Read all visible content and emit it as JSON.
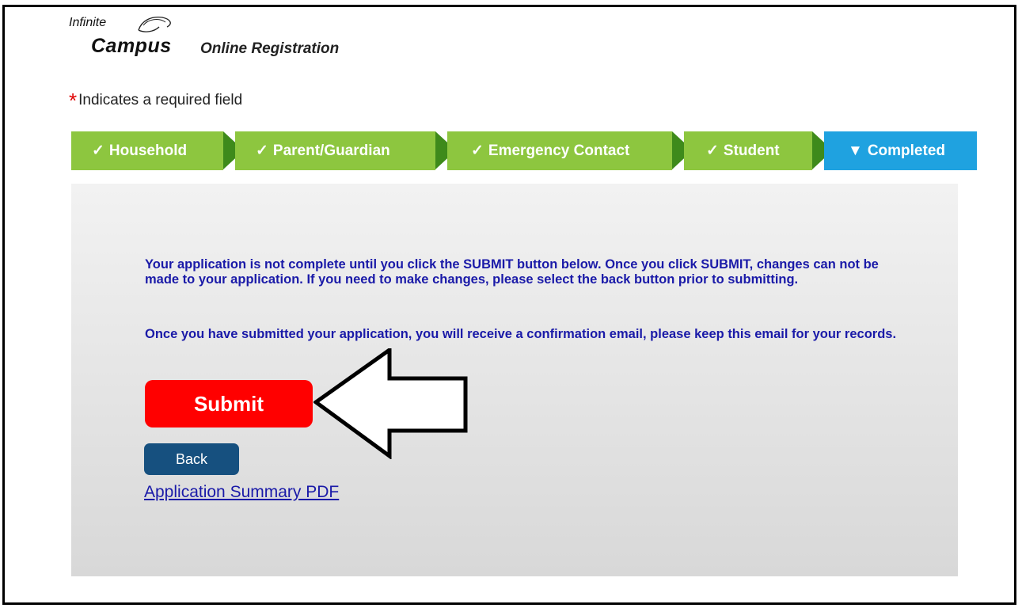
{
  "logo": {
    "line1": "Infinite",
    "line2": "Campus",
    "subtitle": "Online Registration"
  },
  "required_note": {
    "star": "*",
    "text": "Indicates a required field"
  },
  "steps": [
    {
      "label": "Household",
      "state": "completed",
      "icon": "checkmark-icon"
    },
    {
      "label": "Parent/Guardian",
      "state": "completed",
      "icon": "checkmark-icon"
    },
    {
      "label": "Emergency Contact",
      "state": "completed",
      "icon": "checkmark-icon"
    },
    {
      "label": "Student",
      "state": "completed",
      "icon": "checkmark-icon"
    },
    {
      "label": "Completed",
      "state": "current",
      "icon": "triangle-down-icon"
    }
  ],
  "messages": {
    "paragraph1": "Your application is not complete until you click the SUBMIT button below. Once you click SUBMIT, changes can not be made to your application. If you need to make changes, please select the back button prior to submitting.",
    "paragraph2": "Once you have submitted your application, you will receive a confirmation email, please keep this email for your records."
  },
  "buttons": {
    "submit": "Submit",
    "back": "Back"
  },
  "links": {
    "summary": "Application Summary PDF"
  },
  "colors": {
    "step_completed": "#8dc63f",
    "step_current": "#1fa2e0",
    "submit": "#ff0000",
    "back": "#16507f",
    "message_text": "#1a1aa8"
  }
}
